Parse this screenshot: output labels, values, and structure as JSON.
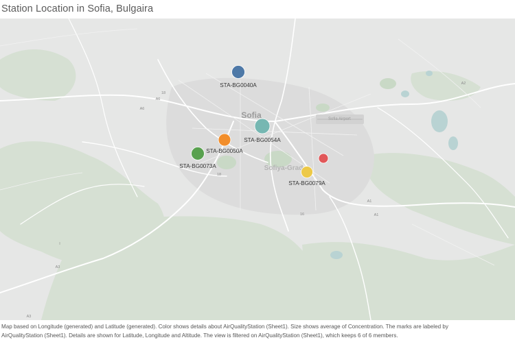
{
  "title": "Station Location in Sofia, Bulgaira",
  "map": {
    "city_label": "Sofia",
    "district_label": "Sofiya-Grad",
    "airport_label": "Sofia Airport",
    "road_labels": [
      "A2",
      "A6",
      "18",
      "A1",
      "16",
      "A1",
      "A6",
      "I",
      "A3",
      "A3",
      "18"
    ]
  },
  "stations": [
    {
      "id": "STA-BG0040A",
      "color": "#4e79a7",
      "size_rank": "medium"
    },
    {
      "id": "STA-BG0054A",
      "color": "#76b7b2",
      "size_rank": "large"
    },
    {
      "id": "STA-BG0050A",
      "color": "#f28e2b",
      "size_rank": "medium"
    },
    {
      "id": "STA-BG0073A",
      "color": "#59a14f",
      "size_rank": "medium"
    },
    {
      "id": "",
      "color": "#e15759",
      "size_rank": "small"
    },
    {
      "id": "STA-BG0079A",
      "color": "#edc948",
      "size_rank": "small-medium"
    }
  ],
  "caption": {
    "line1": "Map based on Longitude (generated) and Latitude (generated).  Color shows details about AirQualityStation (Sheet1).  Size shows average of Concentration.  The marks are labeled by",
    "line2": "AirQualityStation (Sheet1).  Details are shown for Latitude, Longitude and Altitude. The view is filtered on AirQualityStation (Sheet1), which keeps 6 of 6 members."
  }
}
